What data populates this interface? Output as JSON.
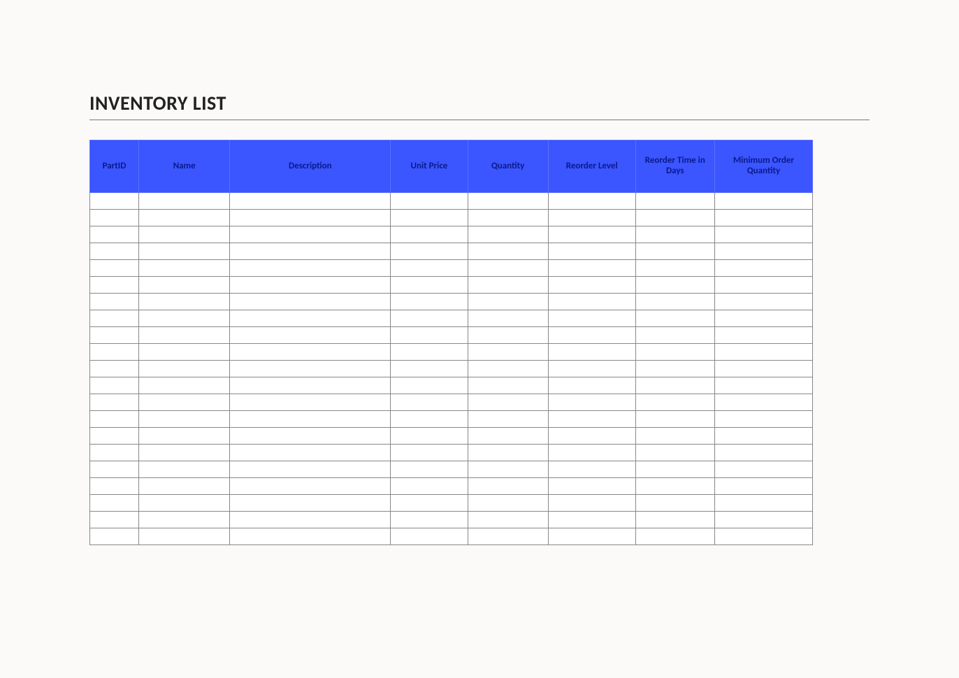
{
  "title": "INVENTORY LIST",
  "columns": [
    "PartID",
    "Name",
    "Description",
    "Unit Price",
    "Quantity",
    "Reorder Level",
    "Reorder Time in Days",
    "Minimum Order Quantity"
  ],
  "row_count": 21,
  "rows": [
    [
      "",
      "",
      "",
      "",
      "",
      "",
      "",
      ""
    ],
    [
      "",
      "",
      "",
      "",
      "",
      "",
      "",
      ""
    ],
    [
      "",
      "",
      "",
      "",
      "",
      "",
      "",
      ""
    ],
    [
      "",
      "",
      "",
      "",
      "",
      "",
      "",
      ""
    ],
    [
      "",
      "",
      "",
      "",
      "",
      "",
      "",
      ""
    ],
    [
      "",
      "",
      "",
      "",
      "",
      "",
      "",
      ""
    ],
    [
      "",
      "",
      "",
      "",
      "",
      "",
      "",
      ""
    ],
    [
      "",
      "",
      "",
      "",
      "",
      "",
      "",
      ""
    ],
    [
      "",
      "",
      "",
      "",
      "",
      "",
      "",
      ""
    ],
    [
      "",
      "",
      "",
      "",
      "",
      "",
      "",
      ""
    ],
    [
      "",
      "",
      "",
      "",
      "",
      "",
      "",
      ""
    ],
    [
      "",
      "",
      "",
      "",
      "",
      "",
      "",
      ""
    ],
    [
      "",
      "",
      "",
      "",
      "",
      "",
      "",
      ""
    ],
    [
      "",
      "",
      "",
      "",
      "",
      "",
      "",
      ""
    ],
    [
      "",
      "",
      "",
      "",
      "",
      "",
      "",
      ""
    ],
    [
      "",
      "",
      "",
      "",
      "",
      "",
      "",
      ""
    ],
    [
      "",
      "",
      "",
      "",
      "",
      "",
      "",
      ""
    ],
    [
      "",
      "",
      "",
      "",
      "",
      "",
      "",
      ""
    ],
    [
      "",
      "",
      "",
      "",
      "",
      "",
      "",
      ""
    ],
    [
      "",
      "",
      "",
      "",
      "",
      "",
      "",
      ""
    ],
    [
      "",
      "",
      "",
      "",
      "",
      "",
      "",
      ""
    ]
  ],
  "colors": {
    "header_bg": "#3b55ff",
    "header_text": "#0a1a8a",
    "cell_border": "#888888",
    "page_bg": "#fbfaf8"
  }
}
